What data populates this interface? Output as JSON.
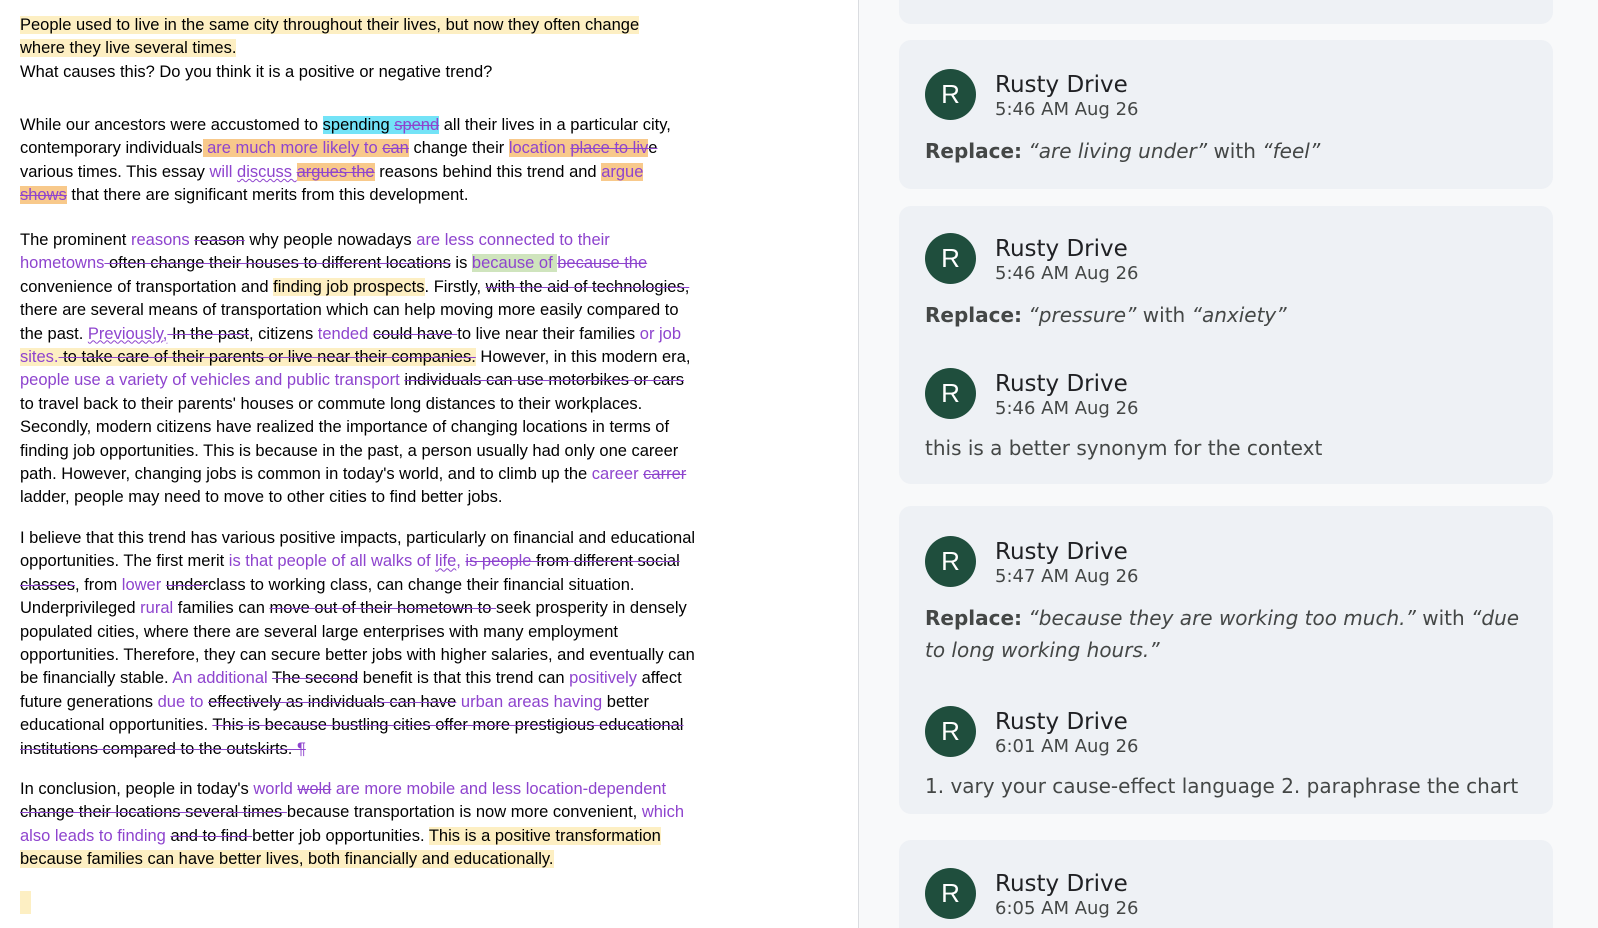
{
  "document": {
    "prompt_line1": "People used to live in the same city throughout their lives, but now they often change",
    "prompt_line2": "where they live several times.",
    "prompt_line3": "What causes this? Do you think it is a positive or negative trend?",
    "p1": {
      "s1": "While our ancestors were accustomed to ",
      "s2": "spending ",
      "s3": "spend",
      "s4": " all their lives in a particular city,",
      "s5": "contemporary individuals",
      "s6": " are much more likely to  ",
      "s7": "can",
      "s8": " change their ",
      "s9": "location ",
      "s10": "place to liv",
      "s11": "e",
      "s12": "various times. This essay ",
      "s13": "will ",
      "s14": "discuss ",
      "s15": " argues the",
      "s16": " reasons behind this trend and ",
      "s17": "argue",
      "s18": "shows",
      "s19": " that there are significant merits from this development."
    },
    "p2": {
      "s1": "The prominent ",
      "s2": "reasons ",
      "s3": "reason",
      "s4": " why people nowadays ",
      "s5": "are less connected to their",
      "s6": "hometowns",
      "s7": " often change their houses to different locations",
      "s8": " is ",
      "s9": "because of ",
      "s10": "because the",
      "s11": "convenience of transportation and ",
      "s12": "finding job prospects",
      "s13": ". Firstly, ",
      "s14": "with the aid of technologies,",
      "s15": "there are several means of transportation which can help moving more easily compared to",
      "s16": "the past. ",
      "s17": "Previously,",
      "s18": " In the past",
      "s19": ", citizens ",
      "s20": "tended ",
      "s21": "could have ",
      "s22": "to live near their families ",
      "s23": "or job",
      "s24": "sites.",
      "s25": "  to take care of their parents or live near their companies.",
      "s26": " However, in this modern era,",
      "s27": "people use a variety of vehicles and public transport ",
      "s28": "individuals can use motorbikes or cars",
      "s29": "to travel back to their parents' houses or commute long distances to their workplaces.",
      "s30": "Secondly, modern citizens have realized the importance of changing locations in terms of",
      "s31": "finding job opportunities. This is because in the past, a person usually had only one career",
      "s32": "path. However, changing jobs is common in today's world, and to climb up the ",
      "s33": "career ",
      "s34": "carrer",
      "s35": "ladder, people may need to move to other cities to find better jobs."
    },
    "p3": {
      "s1": "I believe that this trend has various positive impacts, particularly on financial and educational",
      "s2": "opportunities. The first merit ",
      "s3": "is that people of all walks of ",
      "s4": "life",
      "s5": ", ",
      "s6": "is people",
      "s7": " from different social",
      "s8": "classes",
      "s9": ", from ",
      "s10": "lower ",
      "s11": "under",
      "s12": "class to working class, can change their financial situation.",
      "s13": "Underprivileged ",
      "s14": "rural",
      "s15": " families can ",
      "s16": "move out of their hometown to ",
      "s17": " seek prosperity in densely",
      "s18": "populated cities, where there are several large enterprises with many employment",
      "s19": "opportunities. Therefore, they can secure better jobs with higher salaries, and eventually can",
      "s20": "be financially stable. ",
      "s21": "An additional ",
      "s22": " The second",
      "s23": " benefit is that this trend can ",
      "s24": "positively",
      "s25": " affect",
      "s26": "future generations ",
      "s27": "due to ",
      "s28": " effectively as individuals can have",
      "s29": " ",
      "s30": "urban areas having",
      "s31": " better",
      "s32": "educational opportunities. ",
      "s33": "This is because bustling cities offer more prestigious educational",
      "s34": "institutions compared to the outskirts. ",
      "s35": "¶"
    },
    "p4": {
      "s1": "In conclusion, people in today's ",
      "s2": "world ",
      "s3": "wold",
      "s4": " are more mobile and less location-dependent",
      "s5": "change their locations several times ",
      "s6": "because transportation is now more convenient, ",
      "s7": "which",
      "s8": "also leads to finding ",
      "s9": " and to find ",
      "s10": "better job opportunities. ",
      "s11": "This is a positive transformation",
      "s12": "because families can have better lives, both financially and educationally. "
    }
  },
  "comments": [
    {
      "avatar": "R",
      "author": "Rusty Drive",
      "time": "5:46 AM Aug 26",
      "kind": "Replace:",
      "from": "“are living under”",
      "with": " with ",
      "to": "“feel”"
    },
    {
      "avatar": "R",
      "author": "Rusty Drive",
      "time": "5:46 AM Aug 26",
      "kind": "Replace:",
      "from": "“pressure”",
      "with": " with ",
      "to": "“anxiety”"
    },
    {
      "avatar": "R",
      "author": "Rusty Drive",
      "time": "5:46 AM Aug 26",
      "text": "this is a better synonym for the context"
    },
    {
      "avatar": "R",
      "author": "Rusty Drive",
      "time": "5:47 AM Aug 26",
      "kind": "Replace:",
      "from": "“because they are working too much.”",
      "with": " with ",
      "to": "“due to long working hours.”"
    },
    {
      "avatar": "R",
      "author": "Rusty Drive",
      "time": "6:01 AM Aug 26",
      "text": "1. vary your cause-effect language 2. paraphrase the chart"
    },
    {
      "avatar": "R",
      "author": "Rusty Drive",
      "time": "6:05 AM Aug 26"
    }
  ],
  "colors": {
    "insertion": "#8e44ce",
    "highlight_yellow": "#fdefc3",
    "highlight_orange": "#f8c98b",
    "highlight_cyan": "#73e3f7",
    "highlight_green": "#cfe4bd",
    "avatar_bg": "#1f4e3d",
    "card_bg": "#eef1f5"
  }
}
